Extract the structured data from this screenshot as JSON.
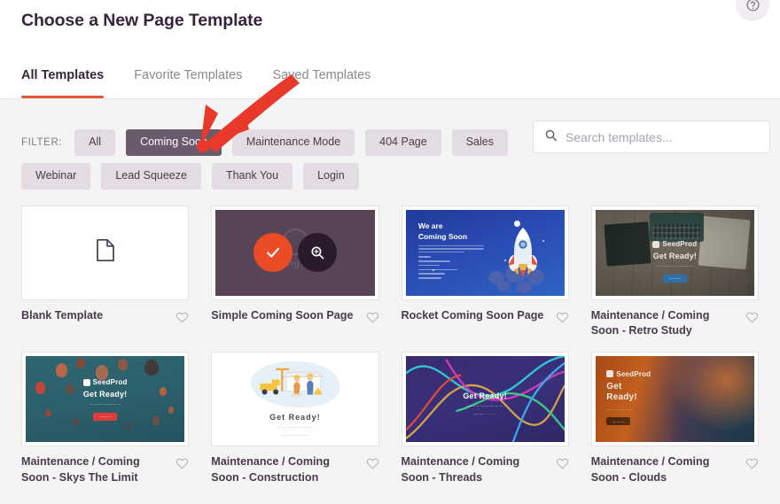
{
  "header": {
    "title": "Choose a New Page Template",
    "help_icon": "question-mark-circle-icon",
    "tabs": [
      {
        "label": "All Templates",
        "active": true
      },
      {
        "label": "Favorite Templates",
        "active": false
      },
      {
        "label": "Saved Templates",
        "active": false
      }
    ]
  },
  "filter": {
    "label": "FILTER:",
    "chips": [
      {
        "label": "All",
        "active": false
      },
      {
        "label": "Coming Soon",
        "active": true
      },
      {
        "label": "Maintenance Mode",
        "active": false
      },
      {
        "label": "404 Page",
        "active": false
      },
      {
        "label": "Sales",
        "active": false
      },
      {
        "label": "Webinar",
        "active": false
      },
      {
        "label": "Lead Squeeze",
        "active": false
      },
      {
        "label": "Thank You",
        "active": false
      },
      {
        "label": "Login",
        "active": false
      }
    ]
  },
  "search": {
    "placeholder": "Search templates...",
    "value": "",
    "icon": "search-icon"
  },
  "templates": [
    {
      "title": "Blank Template",
      "style": "blank",
      "hovered": false
    },
    {
      "title": "Simple Coming Soon Page",
      "style": "simple",
      "hovered": true
    },
    {
      "title": "Rocket Coming Soon Page",
      "style": "rocket",
      "hovered": false
    },
    {
      "title": "Maintenance / Coming Soon - Retro Study",
      "style": "retro",
      "hovered": false
    },
    {
      "title": "Maintenance / Coming Soon - Skys The Limit",
      "style": "sky",
      "hovered": false
    },
    {
      "title": "Maintenance / Coming Soon - Construction",
      "style": "con",
      "hovered": false
    },
    {
      "title": "Maintenance / Coming Soon - Threads",
      "style": "thr",
      "hovered": false
    },
    {
      "title": "Maintenance / Coming Soon - Clouds",
      "style": "cld",
      "hovered": false
    }
  ],
  "thumbnail_text": {
    "brand": "SeedProd",
    "get_ready": "Get Ready!",
    "rocket_heading": "We are\nComing Soon",
    "simple_ghost": "Coming Soon"
  },
  "card_overlay": {
    "select_icon": "check-icon",
    "preview_icon": "magnifier-icon"
  },
  "favorite_icon": "heart-outline-icon",
  "annotation": {
    "type": "arrow",
    "color": "#e8392b",
    "points_at": "Coming Soon"
  },
  "colors": {
    "accent": "#e2563a",
    "chip_active_bg": "#6b5a6d",
    "chip_bg": "#e3dde3",
    "title": "#38243c",
    "page_bg": "#f4f4f4",
    "overlay_check": "#ea4c25",
    "overlay_zoom": "#2a1a2c"
  }
}
